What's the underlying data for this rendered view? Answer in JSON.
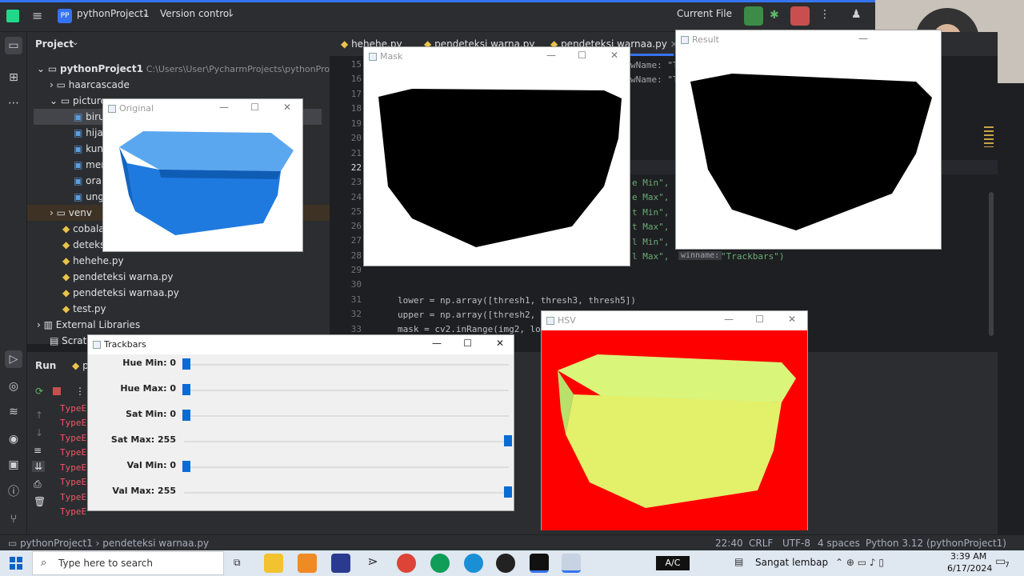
{
  "topbar": {
    "project_badge": "PP",
    "project_name": "pythonProject1",
    "vcs": "Version control",
    "run_config": "Current File"
  },
  "project_panel": {
    "title": "Project",
    "root": "pythonProject1",
    "root_path": "C:\\Users\\User\\PycharmProjects\\pythonProject1",
    "items": [
      {
        "label": "haarcascade"
      },
      {
        "label": "picture"
      },
      {
        "label": "biru"
      },
      {
        "label": "hija"
      },
      {
        "label": "kun"
      },
      {
        "label": "mer"
      },
      {
        "label": "ora"
      },
      {
        "label": "ung"
      },
      {
        "label": "venv"
      },
      {
        "label": "cobala"
      },
      {
        "label": "deteks"
      },
      {
        "label": "hehehe.py"
      },
      {
        "label": "pendeteksi warna.py"
      },
      {
        "label": "pendeteksi warnaa.py"
      },
      {
        "label": "test.py"
      },
      {
        "label": "External Libraries"
      },
      {
        "label": "Scratc"
      }
    ]
  },
  "editor_tabs": [
    {
      "label": "hehehe.py"
    },
    {
      "label": "pendeteksi warna.py"
    },
    {
      "label": "pendeteksi warnaa.py"
    }
  ],
  "line_numbers": [
    "15",
    "16",
    "17",
    "18",
    "19",
    "20",
    "21",
    "22",
    "23",
    "24",
    "25",
    "26",
    "27",
    "28",
    "29",
    "30",
    "31",
    "32",
    "33"
  ],
  "code": {
    "hint1": "wName: \"T",
    "hint2": "wName: \"T",
    "l23": "e Min\",",
    "l24": "e Max\",",
    "l25": "t Min\",",
    "l26": "t Max\",",
    "l27": "l Min\",",
    "l28": "l Max\",",
    "winname": "winname:",
    "trackbars": "\"Trackbars\")",
    "l31": "lower = np.array([thresh1, thresh3, thresh5])",
    "l32": "upper = np.array([thresh2,",
    "l33": "mask = cv2.inRange(img2, lo"
  },
  "windows": {
    "original": "Original",
    "mask": "Mask",
    "result": "Result",
    "hsv": "HSV",
    "trackbars": "Trackbars"
  },
  "trackbars": [
    {
      "label": "Hue Min: 0",
      "value": 0
    },
    {
      "label": "Hue Max: 0",
      "value": 0
    },
    {
      "label": "Sat Min: 0",
      "value": 0
    },
    {
      "label": "Sat Max: 255",
      "value": 255
    },
    {
      "label": "Val Min: 0",
      "value": 0
    },
    {
      "label": "Val Max: 255",
      "value": 255
    }
  ],
  "run_panel": {
    "title": "Run",
    "tab": "p",
    "errors": [
      "TypeE",
      "TypeE",
      "TypeE",
      "TypeE",
      "TypeE",
      "TypeE",
      "TypeE",
      "TypeE"
    ]
  },
  "statusbar": {
    "crumb1": "pythonProject1",
    "crumb2": "pendeteksi warnaa.py",
    "position": "22:40",
    "line_sep": "CRLF",
    "encoding": "UTF-8",
    "indent": "4 spaces",
    "interpreter": "Python 3.12 (pythonProject1)"
  },
  "taskbar": {
    "search_placeholder": "Type here to search",
    "ac": "A/C",
    "weather": "Sangat lembap",
    "time": "3:39 AM",
    "date": "6/17/2024",
    "notif_count": "7"
  },
  "colors": {
    "accent": "#3574f0",
    "hsv_bg": "#ff0000",
    "box_blue": "#1f7ae0"
  }
}
